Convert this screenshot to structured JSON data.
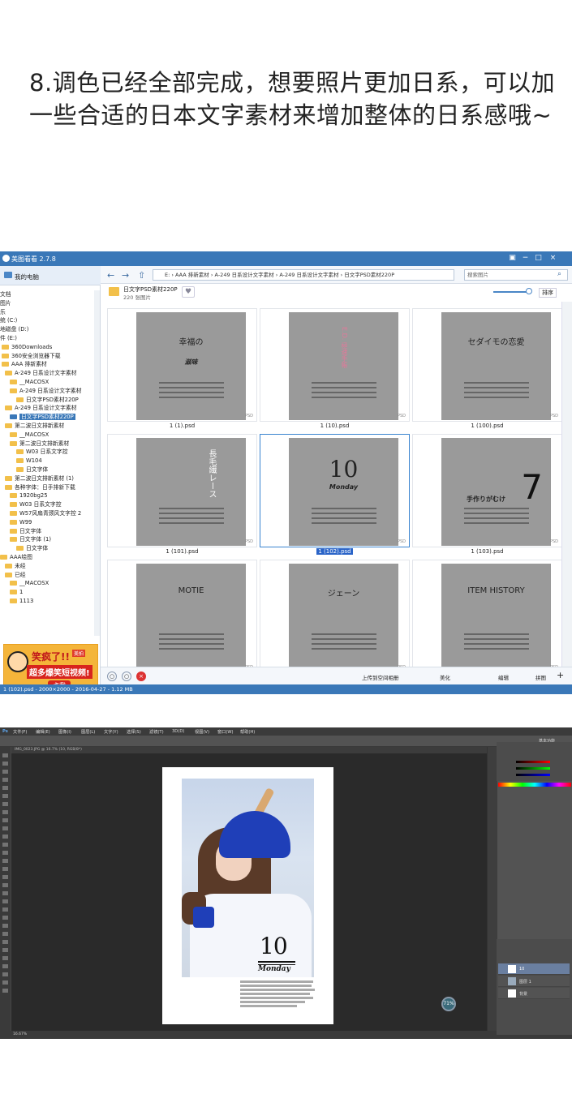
{
  "caption": "8.调色已经全部完成，想要照片更加日系，可以加一些合适的日本文字素材来增加整体的日系感哦~",
  "viewer": {
    "app_name": "美图看看 2.7.8",
    "my_computer": "我的电脑",
    "tree": [
      "文档",
      "图片",
      "乐",
      "统 (C:)",
      "地磁盘 (D:)",
      "件 (E:)",
      "360Downloads",
      "360安全浏览器下载",
      "AAA 排新素材",
      "A-249 日系设计文字素材",
      "__MACOSX",
      "A-249 日系设计文字素材",
      "日文字PSD素材220P",
      "A-249 日系设计文字素材",
      "日文字PSD素材220P",
      "第二波日文排新素材",
      "__MACOSX",
      "第二波日文排新素材",
      "W03 日系文字控",
      "W104",
      "日文字体",
      "第二波日文排新素材 (1)",
      "各种字体：日手排新下载",
      "1920bg25",
      "W03 日系文字控",
      "W57风扇青颈风文字控 2",
      "W99",
      "日文字体",
      "日文字体 (1)",
      "日文字体",
      "AAA绘图",
      "未经",
      "已经",
      "__MACOSX",
      "1",
      "1113"
    ],
    "path": "E: › AAA 排新素材 › A-249 日系设计文字素材 › A-249 日系设计文字素材 › 日文字PSD素材220P",
    "search_placeholder": "搜索图片",
    "folder_name": "日文字PSD素材220P",
    "folder_count": "220 张图片",
    "sort_label": "排序",
    "thumbnails": [
      {
        "label": "1 (1).psd",
        "text_main": "幸福の",
        "text_sub": "滋味"
      },
      {
        "label": "1 (10).psd",
        "text_main": "E.D. 極速手帳"
      },
      {
        "label": "1 (100).psd",
        "text_main": "セダイモの恋愛"
      },
      {
        "label": "1 (101).psd",
        "text_main": "長毛繊レース"
      },
      {
        "label": "1 (102).psd",
        "text_main": "10",
        "text_sub": "Monday"
      },
      {
        "label": "1 (103).psd",
        "text_main": "7",
        "text_sub": "手作りがむけ"
      },
      {
        "label": "",
        "text_main": "MOTIE"
      },
      {
        "label": "",
        "text_main": "ジェーン"
      },
      {
        "label": "",
        "text_main": "ITEM HISTORY"
      }
    ],
    "ad": {
      "title": "笑疯了!!",
      "subtitle": "超多爆笑短视频!",
      "button": "点我",
      "tag": "美拍"
    },
    "bottom_actions": [
      "上传到空间相册",
      "美化",
      "编辑",
      "拼图"
    ],
    "status": "1 (102).psd - 2000×2000 - 2016-04-27 - 1.12 MB"
  },
  "photoshop": {
    "menu": [
      "文件(F)",
      "编辑(E)",
      "图像(I)",
      "图层(L)",
      "文字(Y)",
      "选择(S)",
      "滤镜(T)",
      "3D(D)",
      "视图(V)",
      "窗口(W)",
      "帮助(H)"
    ],
    "workspace": "基本功能",
    "doc_tab": "IMG_0023.JPG @ 16.7% (10, RGB/8*)",
    "doc_big": "10",
    "doc_monday": "Monday",
    "layers": [
      "10",
      "图层 1",
      "背景"
    ],
    "zoom": "16.67%",
    "nav_percent": "71%"
  }
}
